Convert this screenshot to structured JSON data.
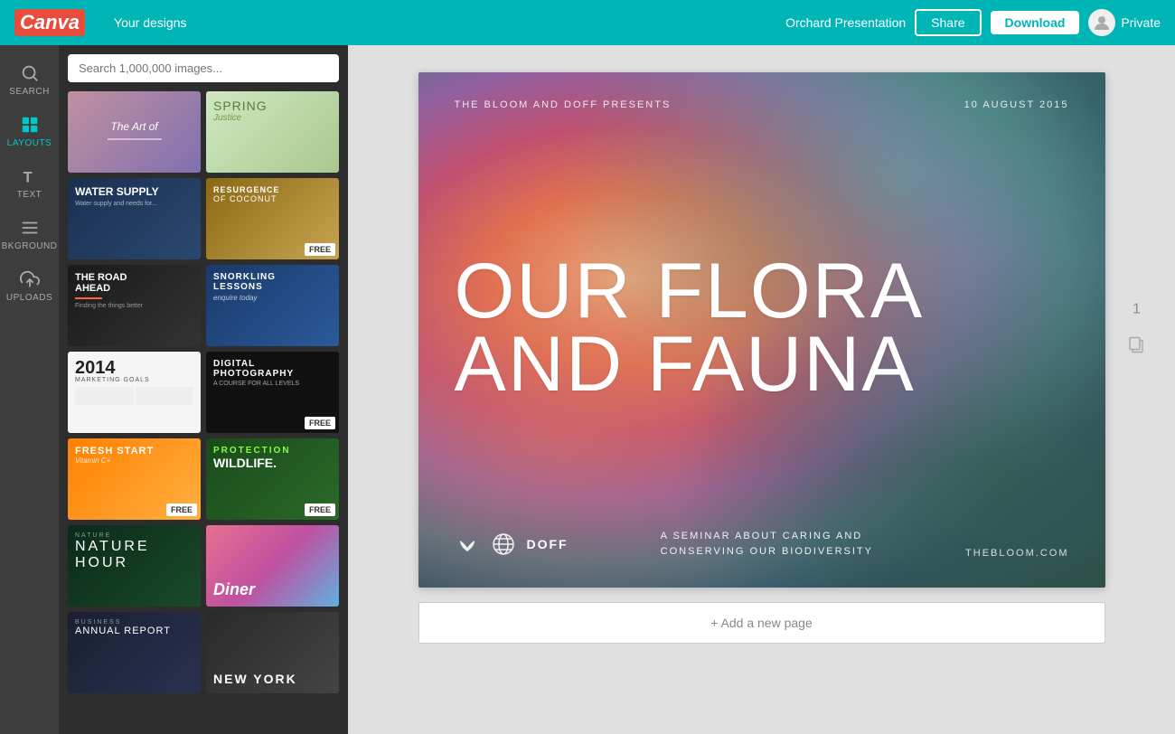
{
  "header": {
    "logo": "Canva",
    "nav_label": "Your designs",
    "project_name": "Orchard Presentation",
    "share_label": "Share",
    "download_label": "Download",
    "private_label": "Private"
  },
  "sidebar": {
    "items": [
      {
        "id": "search",
        "label": "SEARCH",
        "active": false
      },
      {
        "id": "layouts",
        "label": "LAYOUTS",
        "active": true
      },
      {
        "id": "text",
        "label": "TEXT",
        "active": false
      },
      {
        "id": "background",
        "label": "BKGROUND",
        "active": false
      },
      {
        "id": "uploads",
        "label": "UPLOADS",
        "active": false
      }
    ]
  },
  "search": {
    "placeholder": "Search 1,000,000 images..."
  },
  "templates": [
    {
      "id": "t1",
      "label": "The Art of...",
      "type": "photo-collage",
      "free": false
    },
    {
      "id": "t2",
      "label": "Spring Justice",
      "type": "spring",
      "free": false
    },
    {
      "id": "t3",
      "label": "Water Supply",
      "type": "water",
      "free": false
    },
    {
      "id": "t4",
      "label": "Resurgence of Coconut",
      "type": "coconut",
      "free": true
    },
    {
      "id": "t5",
      "label": "The Road Ahead",
      "type": "road",
      "free": false
    },
    {
      "id": "t6",
      "label": "Snorkling Lessons",
      "type": "snorkling",
      "free": false
    },
    {
      "id": "t7",
      "label": "2014 Marketing Goals",
      "type": "infographic",
      "free": false
    },
    {
      "id": "t8",
      "label": "Digital Photography",
      "type": "photo",
      "free": true
    },
    {
      "id": "t9",
      "label": "Fresh Start Vitamin C",
      "type": "food",
      "free": true
    },
    {
      "id": "t10",
      "label": "Protection Wildlife",
      "type": "wildlife",
      "free": true
    },
    {
      "id": "t11",
      "label": "Nature Hour",
      "type": "nature",
      "free": false
    },
    {
      "id": "t12",
      "label": "Diner",
      "type": "diner",
      "free": false
    },
    {
      "id": "t13",
      "label": "Business",
      "type": "business",
      "free": false
    },
    {
      "id": "t14",
      "label": "New York",
      "type": "city",
      "free": false
    }
  ],
  "slide": {
    "presenter": "THE BLOOM AND DOFF PRESENTS",
    "date": "10 AUGUST 2015",
    "main_title_line1": "OUR FLORA",
    "main_title_line2": "AND FAUNA",
    "subtitle": "A SEMINAR ABOUT CARING AND\nCONSERVING OUR BIODIVERSITY",
    "footer_brand": "DOFF",
    "footer_url": "THEBLOOM.COM"
  },
  "canvas": {
    "page_number": "1",
    "add_page_label": "+ Add a new page"
  }
}
